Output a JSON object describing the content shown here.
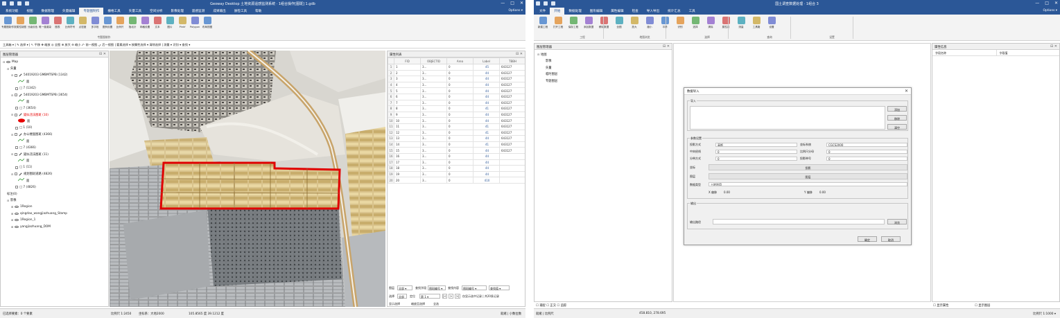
{
  "left_app": {
    "title": "Geoway Desktop 土地资源遥感监测系统 · 1组合操作[图斑] 1.gdb",
    "window_controls": [
      "—",
      "□",
      "✕"
    ],
    "menu": [
      "系统功能",
      "视图",
      "数据管理",
      "矢量编辑",
      "专题图制作",
      "栅格工具",
      "矢量工具",
      "空间分析",
      "影像处理",
      "遥感监测",
      "成果输出",
      "质检工具",
      "帮助"
    ],
    "menu_active_index": 4,
    "menu_right": "Options ▾",
    "ribbon_buttons": [
      "专题图制作",
      "按属性制图",
      "分级设色",
      "唯一值渲染",
      "图表",
      "比例符号",
      "点密度",
      "多字段",
      "图例设置",
      "比例尺",
      "指北针",
      "网格设置",
      "文本",
      "图片",
      "Pinkf",
      "Polygon",
      "布局视图"
    ],
    "ribbon_group": "专题图制作",
    "subbar": "工具箱 ▾ |  ✎ 选择 ▾  |  ↖ 平移 ✥ 缩放 ◎ 全图 ⊕ 放大 ⊖ 缩小 ⤺ 前一视图 ⤻ 后一视图 |  要素选择 ▾ 按属性选择 ▾ 清除选择 |  测量 ▾ 识别 ▾ 查找 ▾",
    "layer_panel": {
      "title": "图层管理器",
      "root": "Map",
      "group1": "矢量",
      "layers": [
        {
          "name": "54019203 GMBMTSPB (1342)",
          "child": "□ 7 (1342)"
        },
        {
          "name": "54019203 GMBMTSPB (3654)",
          "child": "□ 7 (3654)"
        },
        {
          "name": "疑似违法图斑 (10)",
          "child": "□ 1 (10)",
          "highlight": true
        },
        {
          "name": "办公楼面图斑 (4366)",
          "child": "□ 7 (4366)"
        },
        {
          "name": "疑似违法图斑 (11)",
          "child": "□ 1 (11)"
        },
        {
          "name": "规划图斑道路 (4826)",
          "child": "□ 7 (4826)"
        }
      ],
      "sub_labels": [
        "面",
        "面",
        "面",
        "面",
        "面",
        "面"
      ],
      "group2_label": "标注(0)",
      "group3": "影像",
      "images": [
        "1Region",
        "qingdao_wangjiazhuang_Stamp",
        "1Region_1",
        "yangjiazhuang_DOM"
      ]
    },
    "attr_panel": {
      "title": "属性列表",
      "columns": [
        "",
        "FID",
        "OBJECTID",
        "Area",
        "Label",
        "TBBH",
        "XZQDM"
      ],
      "rows": [
        [
          "1",
          "1",
          "3...",
          "0",
          "45",
          "643127"
        ],
        [
          "2",
          "2",
          "3...",
          "0",
          "44",
          "643127"
        ],
        [
          "3",
          "3",
          "3...",
          "0",
          "44",
          "643127"
        ],
        [
          "4",
          "4",
          "3...",
          "0",
          "44",
          "643127"
        ],
        [
          "5",
          "5",
          "3...",
          "0",
          "44",
          "643127"
        ],
        [
          "6",
          "6",
          "3...",
          "0",
          "44",
          "643127"
        ],
        [
          "7",
          "7",
          "3...",
          "0",
          "44",
          "643127"
        ],
        [
          "8",
          "8",
          "3...",
          "0",
          "41",
          "643127"
        ],
        [
          "9",
          "9",
          "3...",
          "0",
          "44",
          "643127"
        ],
        [
          "10",
          "10",
          "3...",
          "0",
          "44",
          "643127"
        ],
        [
          "11",
          "11",
          "3...",
          "0",
          "41",
          "643127"
        ],
        [
          "12",
          "12",
          "3...",
          "0",
          "41",
          "643127"
        ],
        [
          "13",
          "13",
          "3...",
          "0",
          "44",
          "643127"
        ],
        [
          "14",
          "14",
          "3...",
          "0",
          "41",
          "643127"
        ],
        [
          "15",
          "15",
          "3...",
          "0",
          "44",
          "643127"
        ],
        [
          "16",
          "16",
          "3...",
          "0",
          "44",
          ""
        ],
        [
          "17",
          "17",
          "3...",
          "0",
          "44",
          ""
        ],
        [
          "18",
          "18",
          "3...",
          "0",
          "44",
          ""
        ],
        [
          "19",
          "19",
          "3...",
          "0",
          "44",
          ""
        ],
        [
          "20",
          "20",
          "3...",
          "0",
          "410",
          ""
        ]
      ],
      "ctrl1": [
        "图层",
        "全部 ▾",
        "查找字段",
        "图斑编号 ▾",
        "查找内容",
        "图斑编号 ▾",
        "查找值 ▾"
      ],
      "ctrl2": [
        "选择",
        "全部",
        "定位",
        "第 1 ▾",
        "|<",
        ">",
        ">|",
        "仅显示选中记录 | 共20条记录"
      ],
      "ctrl3": [
        "显示选择",
        "缩放至选择",
        "全选"
      ]
    },
    "status": {
      "left": "已选择要素：0 个要素",
      "mid1": "比例尺 1:2450",
      "mid2": "坐标系：大地2000",
      "coords": "105.8565 度 39.1212 度",
      "right": "就绪 | 小数位数"
    }
  },
  "right_app": {
    "title": "国土调查数据处理 · 1组合 3",
    "window_controls": [
      "—",
      "□",
      "✕"
    ],
    "menu": [
      "文件",
      "开始",
      "数据处理",
      "图形编辑",
      "属性编辑",
      "检查",
      "导入导出",
      "统计汇总",
      "工具"
    ],
    "menu_active_index": 1,
    "menu_right": "Options ▾",
    "ribbon_buttons": [
      "新建工程",
      "打开工程",
      "保存工程",
      "添加数据",
      "移除数据",
      "全图",
      "放大",
      "缩小",
      "平移",
      "识别",
      "选择",
      "清除",
      "属性表",
      "测量",
      "工具箱",
      "设置"
    ],
    "ribbon_groups": [
      "工程",
      "地图浏览",
      "选择",
      "查询",
      "设置"
    ],
    "layer_panel": {
      "title": "图层管理器",
      "items": [
        "地图",
        "影像",
        "矢量",
        "临时图层",
        "专题图层"
      ]
    },
    "right_panel": {
      "title": "属性信息",
      "columns": [
        "字段名称",
        "字段值"
      ]
    },
    "dialog": {
      "title": "数据导入",
      "section1": "导入",
      "btn_add": "添加",
      "btn_remove": "移除",
      "btn_clear": "清空",
      "section2": "参数设置",
      "fields": [
        {
          "label": "投影方式",
          "value": "高斯"
        },
        {
          "label": "中央经线",
          "value": "0"
        },
        {
          "label": "分带方式",
          "value": "0"
        },
        {
          "label": "坐标系统",
          "value": "CGCS2000"
        },
        {
          "label": "比例尺分母",
          "value": "0"
        },
        {
          "label": "投影带号",
          "value": "0"
        }
      ],
      "bar1": "投影",
      "bar2": "图层",
      "dropdown_label": "数据类型",
      "dropdown_value": "土地利用",
      "x_label": "X 偏移",
      "x_value": "0.00",
      "y_label": "Y 偏移",
      "y_value": "0.00",
      "section3": "输出",
      "out_label": "输出路径",
      "out_value": "",
      "btn_browse": "浏览",
      "btn_ok": "确定",
      "btn_cancel": "取消"
    },
    "status": {
      "left": "☐ 捕捉  ☐ 正交  ☐ 追踪",
      "left2": "就绪  |  比例尺",
      "coords": "458.810, 278.695",
      "mid": "☐ 显示属性",
      "right": "☐ 显示图层",
      "far": "比例尺 1:1000 ▾"
    }
  },
  "colors": {
    "titlebar": "#2b5797",
    "highlight_outline": "#e00000",
    "legend_red": "#e60000",
    "link_blue": "#2b5797"
  }
}
